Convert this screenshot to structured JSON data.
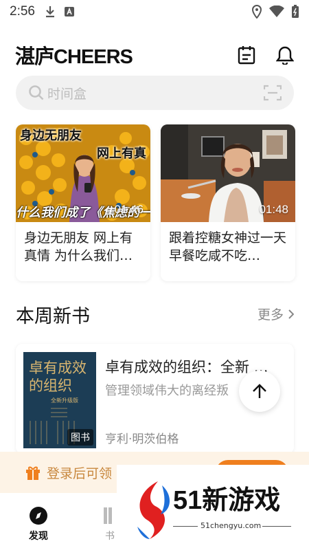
{
  "status_bar": {
    "time": "2:56"
  },
  "header": {
    "logo": "湛庐CHEERS"
  },
  "search": {
    "placeholder": "时间盒"
  },
  "videos": [
    {
      "title": "身边无朋友 网上有真情 为什么我们…",
      "duration": "01:46",
      "thumb_text_1": "身边无朋友",
      "thumb_text_2": "网上有真",
      "thumb_text_3": "什么我们成了《焦虑的一"
    },
    {
      "title": "跟着控糖女神过一天 早餐吃咸不吃…",
      "duration": "01:48"
    }
  ],
  "section": {
    "title": "本周新书",
    "more": "更多"
  },
  "book": {
    "title": "卓有成效的组织：全新 …",
    "description": "管理领域伟大的离经叛",
    "author": "亨利·明茨伯格",
    "badge": "图书",
    "cover_title": "卓有成效的组织",
    "cover_subtitle": "全新升级版"
  },
  "login_banner": {
    "text": "登录后可领"
  },
  "bottom_nav": {
    "items": [
      {
        "label": "发现"
      },
      {
        "label": "书"
      }
    ]
  },
  "watermark": {
    "text": "51新游戏",
    "url": "51chengyu.com"
  },
  "colors": {
    "accent": "#ef7f1e",
    "banner_bg": "#fdf3e6",
    "banner_text": "#c8873d"
  }
}
